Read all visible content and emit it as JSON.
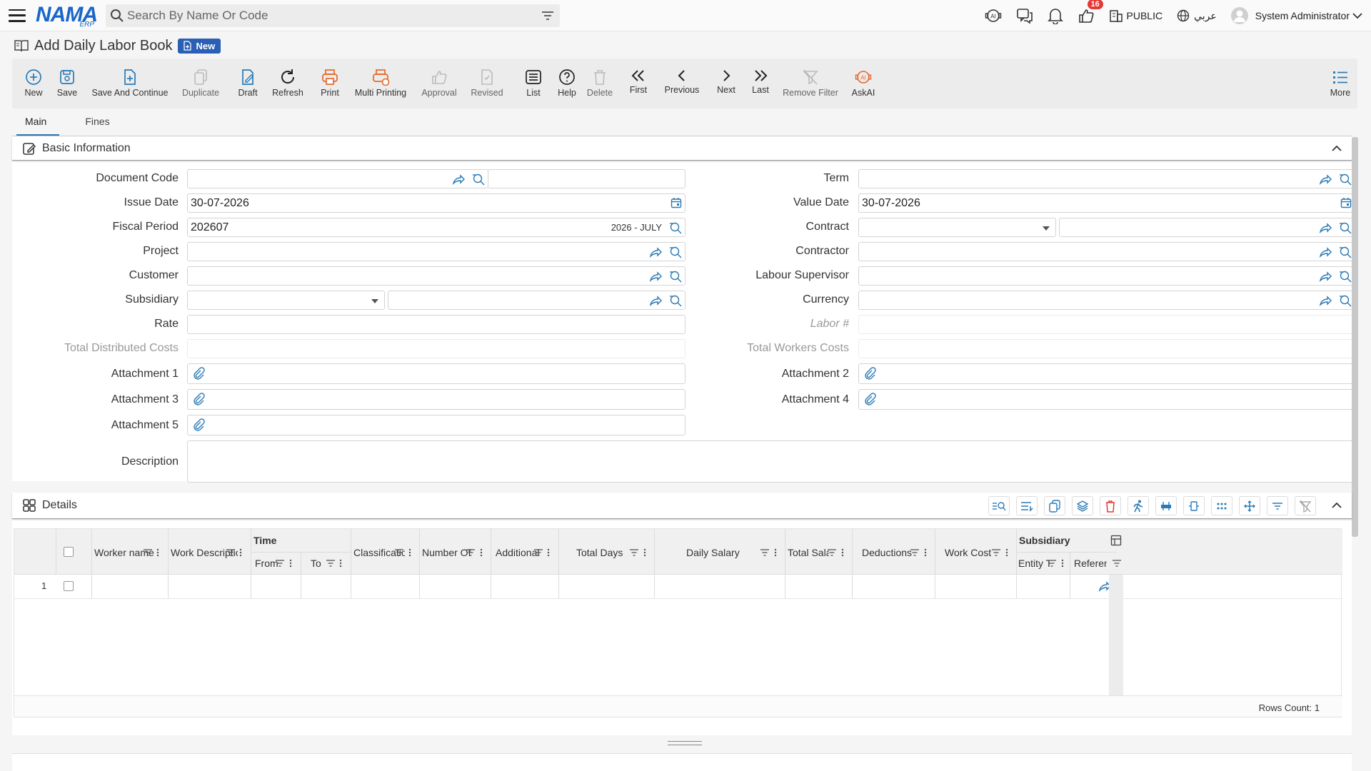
{
  "topbar": {
    "search_placeholder": "Search By Name Or Code",
    "logo_text": "NAMA",
    "logo_sub": "ERP",
    "notif_count": "16",
    "branch": "PUBLIC",
    "language": "عربي",
    "user": "System Administrator"
  },
  "page": {
    "title": "Add Daily Labor Book",
    "badge": "New"
  },
  "toolbar": [
    "New",
    "Save",
    "Save And Continue",
    "Duplicate",
    "Draft",
    "Refresh",
    "Print",
    "Multi Printing",
    "Approval",
    "Revised",
    "List",
    "Help",
    "Delete",
    "First",
    "Previous",
    "Next",
    "Last",
    "Remove Filter",
    "AskAI",
    "More"
  ],
  "tabs": [
    "Main",
    "Fines"
  ],
  "basic": {
    "title": "Basic Information",
    "labels": {
      "doc_code": "Document Code",
      "issue_date": "Issue Date",
      "fiscal_period": "Fiscal Period",
      "project": "Project",
      "customer": "Customer",
      "subsidiary": "Subsidiary",
      "rate": "Rate",
      "total_dist": "Total Distributed Costs",
      "att1": "Attachment 1",
      "att3": "Attachment 3",
      "att5": "Attachment 5",
      "description": "Description",
      "term": "Term",
      "value_date": "Value Date",
      "contract": "Contract",
      "contractor": "Contractor",
      "labour_sup": "Labour Supervisor",
      "currency": "Currency",
      "labor_no": "Labor #",
      "total_workers": "Total Workers Costs",
      "att2": "Attachment 2",
      "att4": "Attachment 4"
    },
    "values": {
      "issue_date": "30-07-2026",
      "fiscal_period": "202607",
      "fiscal_tag": "2026 - JULY",
      "value_date": "30-07-2026"
    }
  },
  "details": {
    "title": "Details",
    "headers": {
      "worker": "Worker name",
      "work_desc": "Work Descriptio",
      "time": "Time",
      "from": "From",
      "to": "To",
      "classification": "Classificatio",
      "number_of": "Number Of I",
      "additional": "Additional",
      "total_days": "Total Days",
      "daily_salary": "Daily Salary",
      "total_salary": "Total Salar",
      "deductions": "Deductions",
      "work_cost": "Work Cost",
      "subsidiary": "Subsidiary",
      "entity_type": "Entity Ty",
      "reference": "Referen"
    },
    "row_no": "1",
    "rows_count": "Rows Count: 1"
  },
  "colors": {
    "accent": "#2a7ab5",
    "orange": "#e8672a",
    "brand": "#1a66c8"
  }
}
